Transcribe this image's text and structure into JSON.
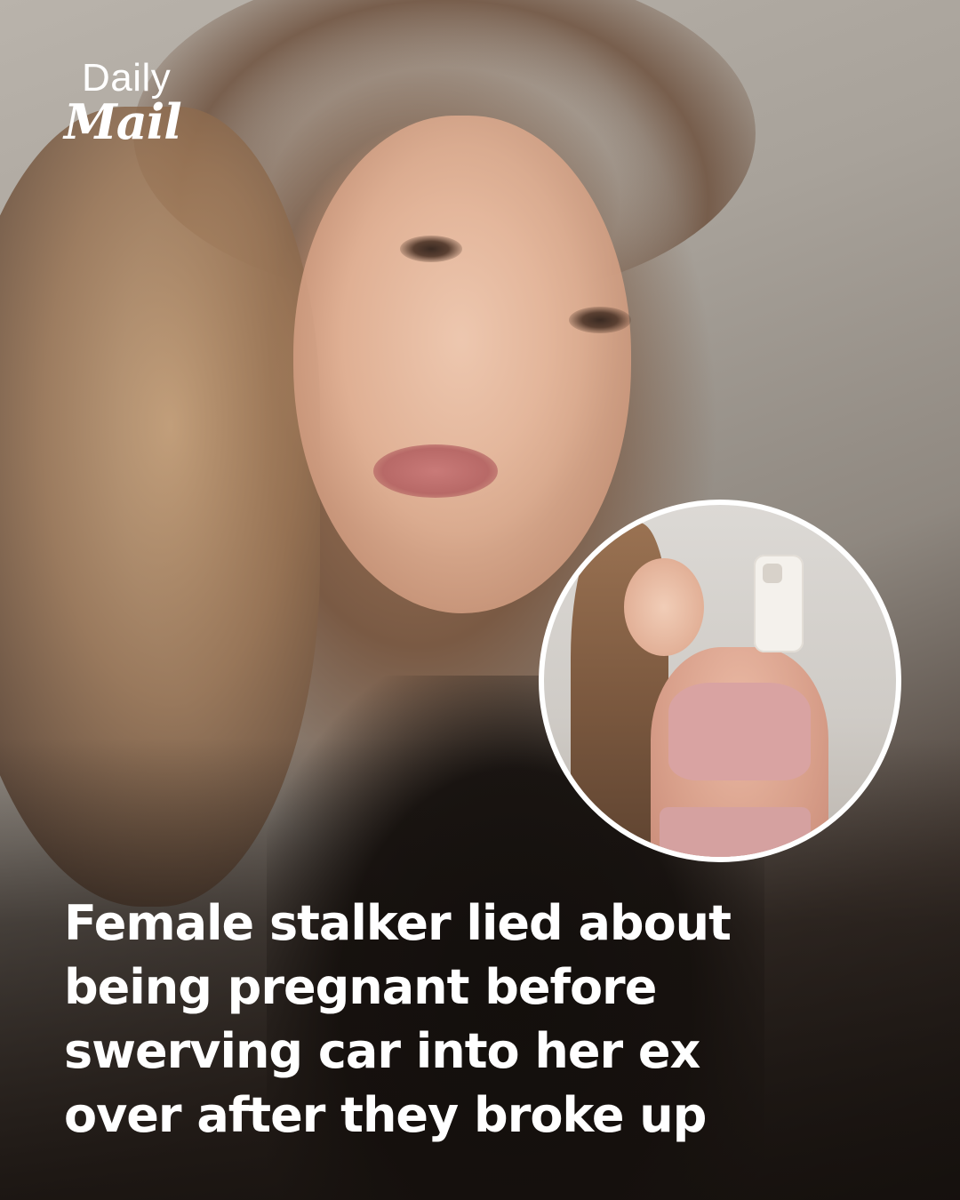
{
  "logo": {
    "daily": "Daily",
    "mail": "Mail"
  },
  "headline": {
    "lines": [
      "Female stalker lied about",
      "being pregnant before",
      "swerving car into her ex",
      "over after they broke up"
    ]
  },
  "colors": {
    "text": "#ffffff",
    "inset_border": "#ffffff"
  }
}
